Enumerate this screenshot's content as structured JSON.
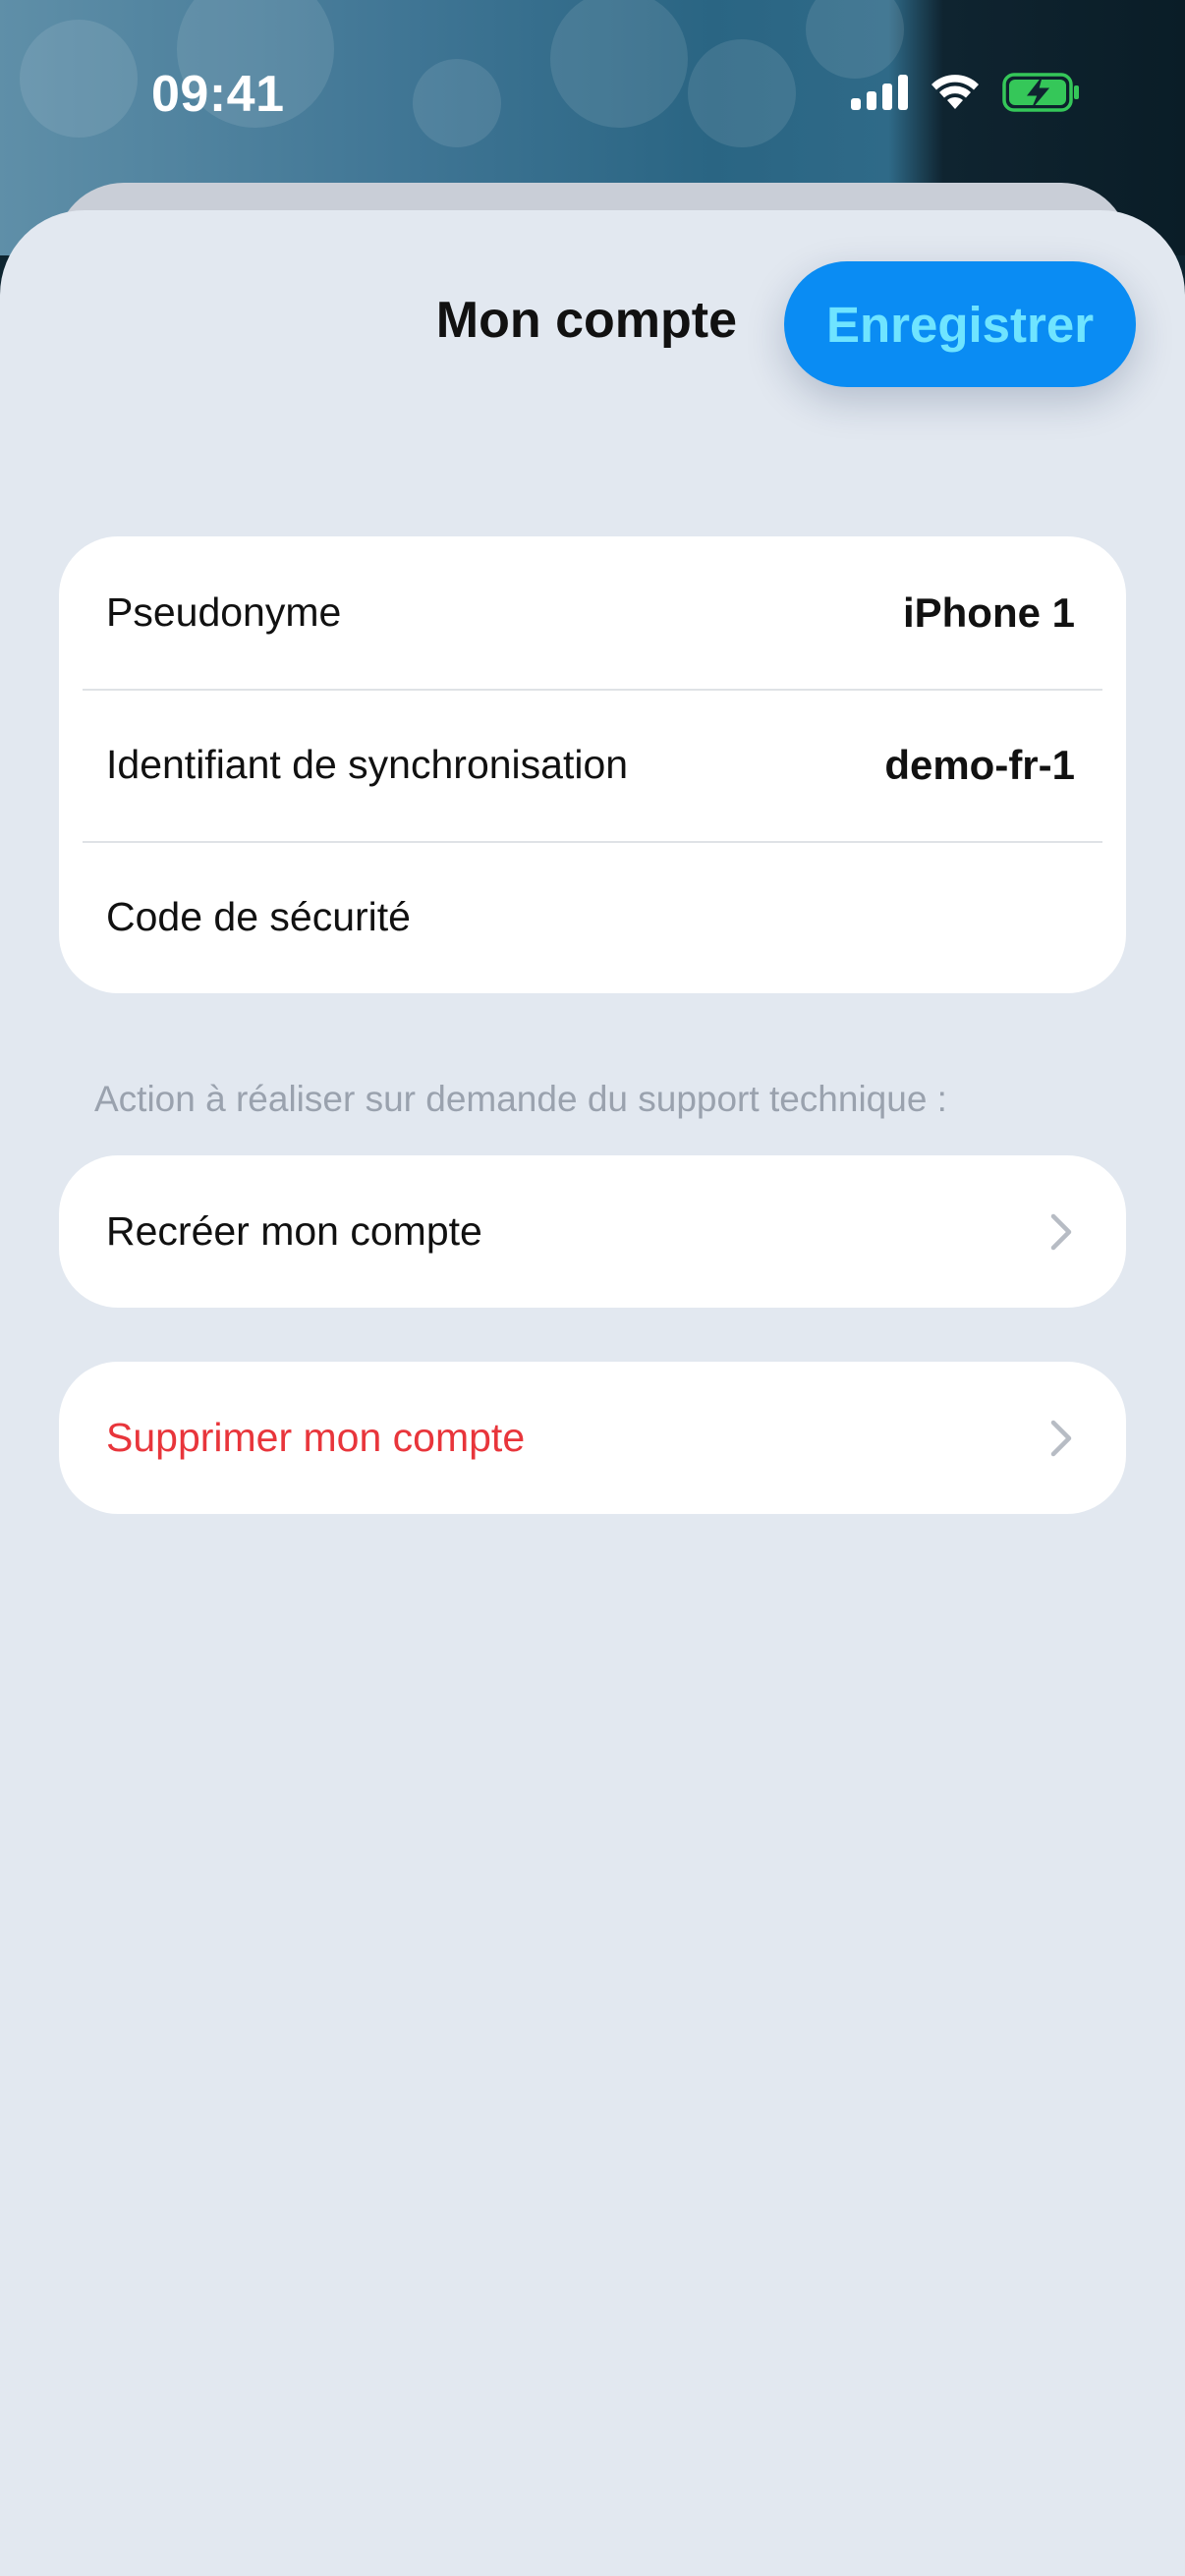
{
  "status_bar": {
    "time": "09:41",
    "icons": [
      "cellular-signal-icon",
      "wifi-icon",
      "battery-charging-icon"
    ],
    "battery_color": "#35c759"
  },
  "header": {
    "title": "Mon compte",
    "save_label": "Enregistrer"
  },
  "account": {
    "rows": [
      {
        "label": "Pseudonyme",
        "value": "iPhone 1"
      },
      {
        "label": "Identifiant de synchronisation",
        "value": "demo-fr-1"
      },
      {
        "label": "Code de sécurité",
        "value": ""
      }
    ]
  },
  "support": {
    "note": "Action à réaliser sur demande du support technique :",
    "recreate_label": "Recréer mon compte"
  },
  "danger": {
    "delete_label": "Supprimer mon compte",
    "color": "#e8353b"
  },
  "colors": {
    "accent": "#0a8cf3",
    "accent_text": "#6fe4ff",
    "sheet_background": "#e2e8f0"
  }
}
